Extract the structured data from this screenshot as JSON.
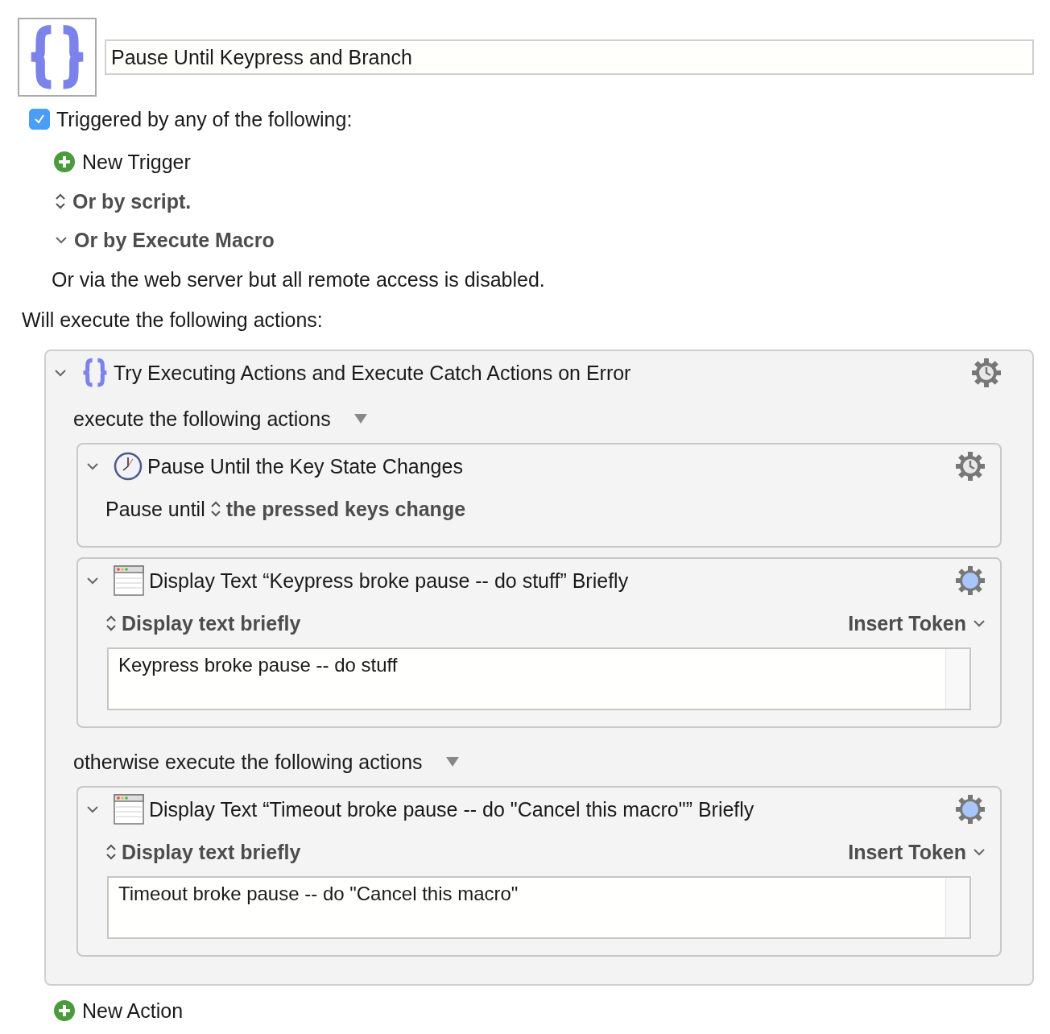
{
  "macro": {
    "name": "Pause Until Keypress and Branch"
  },
  "triggers": {
    "checked": true,
    "label": "Triggered by any of the following:",
    "new_trigger": "New Trigger",
    "options": [
      {
        "kind": "stepper",
        "label": "Or by script."
      },
      {
        "kind": "disclosure",
        "label": "Or by Execute Macro"
      }
    ],
    "web_note": "Or via the web server but all remote access is disabled."
  },
  "actions_heading": "Will execute the following actions:",
  "group": {
    "expanded": true,
    "title": "Try Executing Actions and Execute Catch Actions on Error",
    "sections": [
      {
        "label": "execute the following actions",
        "actions": [
          {
            "kind": "pause",
            "expanded": true,
            "title": "Pause Until the Key State Changes",
            "prefix": "Pause until",
            "option": "the pressed keys change"
          },
          {
            "kind": "display_text",
            "expanded": true,
            "title": "Display Text “Keypress broke pause -- do stuff” Briefly",
            "mode": "Display text briefly",
            "token_menu": "Insert Token",
            "text": "Keypress broke pause -- do stuff"
          }
        ]
      },
      {
        "label": "otherwise execute the following actions",
        "actions": [
          {
            "kind": "display_text",
            "expanded": true,
            "title": "Display Text “Timeout broke pause -- do \"Cancel this macro\"” Briefly",
            "mode": "Display text briefly",
            "token_menu": "Insert Token",
            "text": "Timeout broke pause -- do \"Cancel this macro\""
          }
        ]
      }
    ]
  },
  "new_action": "New Action"
}
